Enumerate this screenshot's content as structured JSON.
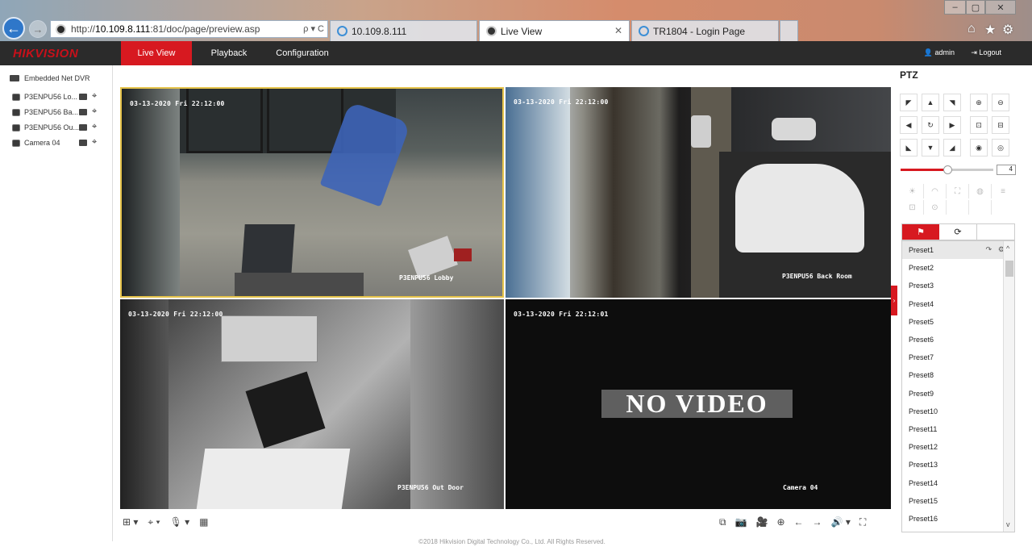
{
  "browser": {
    "url_prefix": "http://",
    "url_host": "10.109.8.111",
    "url_rest": ":81/doc/page/preview.asp",
    "url_tools": "ρ ▾ C",
    "tabs": [
      {
        "label": "10.109.8.111"
      },
      {
        "label": "Live View",
        "close": "✕"
      },
      {
        "label": "TR1804 - Login Page"
      }
    ],
    "window_buttons": [
      "–",
      "▢",
      "✕"
    ],
    "top_icons": [
      "⌂",
      "★",
      "⚙"
    ]
  },
  "app": {
    "logo": "HIKVISION",
    "nav": [
      {
        "label": "Live View",
        "active": true
      },
      {
        "label": "Playback",
        "active": false
      },
      {
        "label": "Configuration",
        "active": false
      }
    ],
    "user": "admin",
    "logout": "Logout"
  },
  "devices": {
    "root": "Embedded Net DVR",
    "cameras": [
      {
        "label": "P3ENPU56 Lo..."
      },
      {
        "label": "P3ENPU56 Ba..."
      },
      {
        "label": "P3ENPU56 Ou..."
      },
      {
        "label": "Camera 04"
      }
    ]
  },
  "videos": [
    {
      "timestamp": "03-13-2020 Fri 22:12:00",
      "name": "P3ENPU56 Lobby"
    },
    {
      "timestamp": "03-13-2020 Fri 22:12:00",
      "name": "P3ENPU56 Back Room"
    },
    {
      "timestamp": "03-13-2020 Fri 22:12:00",
      "name": "P3ENPU56 Out Door"
    },
    {
      "timestamp": "03-13-2020 Fri 22:12:01",
      "name": "Camera 04",
      "overlay": "NO VIDEO"
    }
  ],
  "toolbar": {
    "left": [
      "⊞ ▾",
      "⌖ ▾",
      "🎙 ▾",
      "▦"
    ],
    "right": [
      "⧉",
      "📷",
      "🎥",
      "⊕",
      "←",
      "→",
      "🔊 ▾",
      "⛶"
    ]
  },
  "footer": "©2018 Hikvision Digital Technology Co., Ltd. All Rights Reserved.",
  "ptz": {
    "title": "PTZ",
    "direction_buttons": [
      "◤",
      "▲",
      "◥",
      "◀",
      "↻",
      "▶",
      "◣",
      "▼",
      "◢"
    ],
    "zoom_buttons": [
      "⊕",
      "⊖",
      "⊡",
      "⊟",
      "◉",
      "◎"
    ],
    "speed": "4",
    "speed_fraction": 0.5,
    "preset_tab_icons": [
      "⚑",
      "⟳"
    ],
    "presets": [
      "Preset1",
      "Preset2",
      "Preset3",
      "Preset4",
      "Preset5",
      "Preset6",
      "Preset7",
      "Preset8",
      "Preset9",
      "Preset10",
      "Preset11",
      "Preset12",
      "Preset13",
      "Preset14",
      "Preset15",
      "Preset16"
    ],
    "preset_actions": [
      "↷",
      "⚙"
    ]
  },
  "colors": {
    "accent": "#d71920",
    "navbar": "#2b2b2b",
    "selected_border": "#e5c34a"
  }
}
